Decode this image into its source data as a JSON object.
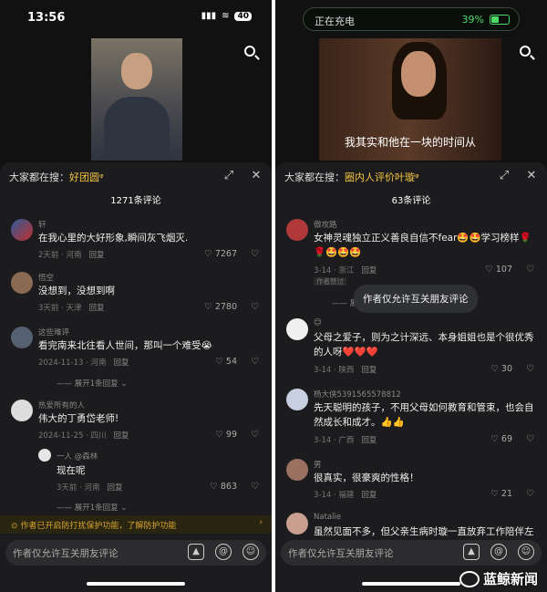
{
  "left": {
    "status": {
      "time": "13:56",
      "battery": "40"
    },
    "search_label": "大家都在搜：",
    "search_keyword": "好团圆",
    "comment_count": "1271条评论",
    "comments": [
      {
        "name": "轩",
        "text": "在我心里的大好形象,瞬间灰飞烟灭.",
        "time": "2天前 · 河南",
        "reply": "回复",
        "likes": "7267"
      },
      {
        "name": "悟空",
        "text": "没想到，没想到啊",
        "time": "3天前 · 天津",
        "reply": "回复",
        "likes": "2780"
      },
      {
        "name": "这些难评",
        "text": "看完南来北往看人世间，那叫一个难受😭",
        "time": "2024-11-13 · 河南",
        "reply": "回复",
        "likes": "54",
        "expand": "展开1条回复"
      },
      {
        "name": "热爱所有的人",
        "text": "伟大的丁勇岱老师!",
        "time": "2024-11-25 · 四川",
        "reply": "回复",
        "likes": "99"
      }
    ],
    "sub_comment": {
      "name": "一人 @森林",
      "text": "现在呢",
      "time": "3天前 · 河南",
      "reply": "回复",
      "likes": "863",
      "expand": "展开1条回复"
    },
    "protect_text": "作者已开启防打扰保护功能，了解防护功能",
    "input_placeholder": "作者仅允许互关朋友评论"
  },
  "right": {
    "charging_label": "正在充电",
    "charging_pct": "39%",
    "subtitle": "我其实和他在一块的时间从",
    "search_label": "大家都在搜：",
    "search_keyword": "圈内人评价叶璇",
    "comment_count": "63条评论",
    "comments": [
      {
        "name": "傲攻路",
        "text": "女神灵魂独立正义善良自信不fear🤩🤩学习榜样🌹🌹🤩🤩🤩",
        "time": "3-14 · 浙江",
        "reply": "回复",
        "likes": "107",
        "tag": "作者赞过",
        "expand": "展开"
      },
      {
        "name": "😊",
        "text": "父母之爱子，则为之计深远、本身姐姐也是个很优秀的人呀❤️❤️❤️",
        "time": "3-14 · 陕西",
        "reply": "回复",
        "likes": "30"
      },
      {
        "name": "杨大侠5391565578812",
        "text": "先天聪明的孩子，不用父母如何教育和管束，也会自然成长和成才。👍👍",
        "time": "3-14 · 广西",
        "reply": "回复",
        "likes": "69"
      },
      {
        "name": "男",
        "text": "很真实，很豪爽的性格！",
        "time": "3-14 · 福建",
        "reply": "回复",
        "likes": "21"
      },
      {
        "name": "Natalie",
        "text": "虽然见面不多，但父亲生病时璇一直放弃工作陪伴左右",
        "time": "",
        "reply": "",
        "likes": ""
      }
    ],
    "tooltip": "作者仅允许互关朋友评论",
    "input_placeholder": "作者仅允许互关朋友评论"
  },
  "watermark": "蓝鲸新闻",
  "colors": {
    "keyword": "#f4c542",
    "protect": "#d8a530",
    "charging": "#4cd964"
  }
}
